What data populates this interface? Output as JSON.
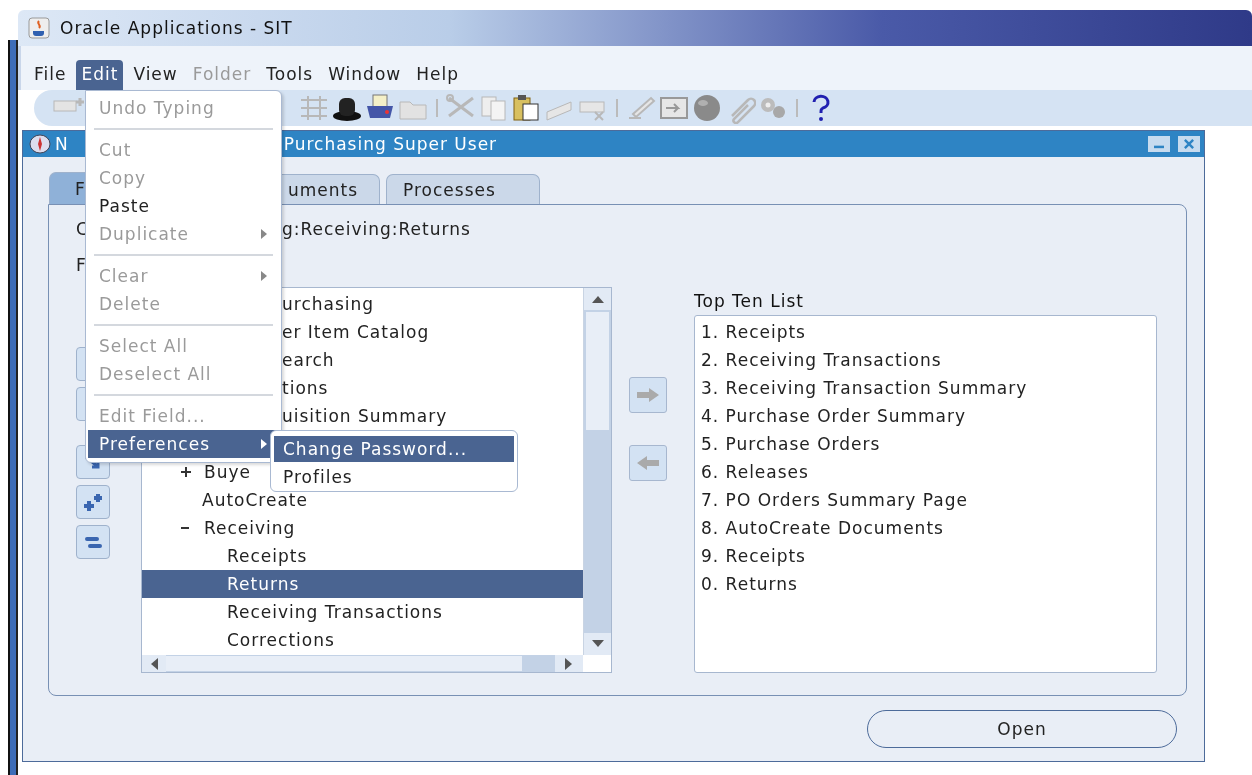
{
  "window": {
    "title": "Oracle Applications - SIT"
  },
  "menubar": [
    {
      "label": "File",
      "selected": false,
      "disabled": false
    },
    {
      "label": "Edit",
      "selected": true,
      "disabled": false
    },
    {
      "label": "View",
      "selected": false,
      "disabled": false
    },
    {
      "label": "Folder",
      "selected": false,
      "disabled": true
    },
    {
      "label": "Tools",
      "selected": false,
      "disabled": false
    },
    {
      "label": "Window",
      "selected": false,
      "disabled": false
    },
    {
      "label": "Help",
      "selected": false,
      "disabled": false
    }
  ],
  "navigator": {
    "title_start": "N",
    "title_end": "Purchasing Super User",
    "tabs": [
      {
        "label": "F",
        "selected": true
      },
      {
        "label": "uments",
        "selected": false
      },
      {
        "label": "Processes",
        "selected": false
      }
    ],
    "function_label": "C",
    "function_value": "g:Receiving:Returns",
    "label_2": "F",
    "tree": [
      {
        "label": "urchasing",
        "kind": "fragment",
        "selected": false
      },
      {
        "label": "er Item Catalog",
        "kind": "fragment",
        "selected": false
      },
      {
        "label": "earch",
        "kind": "fragment",
        "selected": false
      },
      {
        "label": "tions",
        "kind": "fragment",
        "selected": false
      },
      {
        "label": "uisition Summary",
        "kind": "fragment",
        "selected": false
      },
      {
        "label": "Buye",
        "kind": "node",
        "expanded": false,
        "selected": false
      },
      {
        "label": "AutoCreate",
        "kind": "leaf",
        "selected": false
      },
      {
        "label": "Receiving",
        "kind": "node",
        "expanded": true,
        "selected": false,
        "children": [
          {
            "label": "Receipts",
            "kind": "leaf",
            "selected": false
          },
          {
            "label": "Returns",
            "kind": "leaf",
            "selected": true
          },
          {
            "label": "Receiving Transactions",
            "kind": "leaf",
            "selected": false
          },
          {
            "label": "Corrections",
            "kind": "leaf",
            "selected": false
          }
        ]
      }
    ],
    "top_ten": {
      "title": "Top Ten List",
      "items": [
        "1. Receipts",
        "2. Receiving Transactions",
        "3. Receiving Transaction Summary",
        "4. Purchase Order Summary",
        "5. Purchase Orders",
        "6. Releases",
        "7. PO Orders Summary Page",
        "8. AutoCreate Documents",
        "9. Receipts",
        "0. Returns"
      ]
    },
    "open_button": "Open"
  },
  "edit_menu": [
    [
      {
        "label": "Undo Typing",
        "disabled": true,
        "selected": false,
        "submenu": false
      }
    ],
    [
      {
        "label": "Cut",
        "disabled": true,
        "selected": false,
        "submenu": false
      },
      {
        "label": "Copy",
        "disabled": true,
        "selected": false,
        "submenu": false
      },
      {
        "label": "Paste",
        "disabled": false,
        "selected": false,
        "submenu": false
      },
      {
        "label": "Duplicate",
        "disabled": true,
        "selected": false,
        "submenu": true
      }
    ],
    [
      {
        "label": "Clear",
        "disabled": true,
        "selected": false,
        "submenu": true
      },
      {
        "label": "Delete",
        "disabled": true,
        "selected": false,
        "submenu": false
      }
    ],
    [
      {
        "label": "Select All",
        "disabled": true,
        "selected": false,
        "submenu": false
      },
      {
        "label": "Deselect All",
        "disabled": true,
        "selected": false,
        "submenu": false
      }
    ],
    [
      {
        "label": "Edit Field...",
        "disabled": true,
        "selected": false,
        "submenu": false
      },
      {
        "label": "Preferences",
        "disabled": false,
        "selected": true,
        "submenu": true
      }
    ]
  ],
  "preferences_menu": [
    {
      "label": "Change Password...",
      "selected": true
    },
    {
      "label": "Profiles",
      "selected": false
    }
  ]
}
